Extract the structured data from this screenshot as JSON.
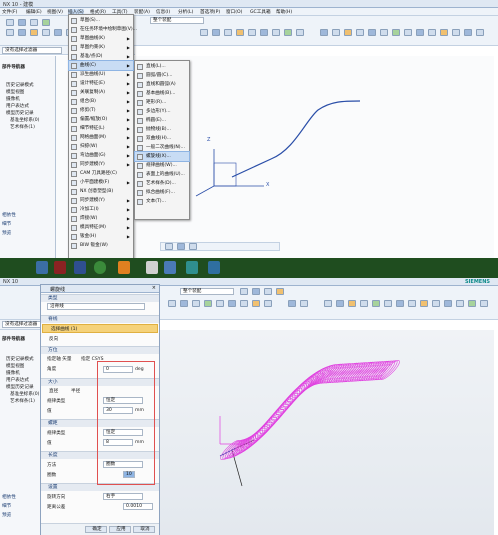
{
  "top": {
    "title_left": "NX 10 - 建模",
    "title_right": "SIEMENS",
    "menubar": [
      "文件(F)",
      "编辑(E)",
      "视图(V)",
      "插入(S)",
      "格式(R)",
      "工具(T)",
      "装配(A)",
      "信息(I)",
      "分析(L)",
      "首选项(P)",
      "窗口(O)",
      "GC工具箱",
      "帮助(H)"
    ],
    "filter_select": "整个装配",
    "left_select": "没有选择过滤器",
    "nav_title": "部件导航器",
    "nav_items": [
      "历史记录模式",
      "模型视图",
      "摄像机",
      "用户表达式",
      "模型历史记录",
      "基准坐标系(0)",
      "艺术样条(1)"
    ],
    "nav_bottom": [
      "相依性",
      "细节",
      "预览"
    ]
  },
  "insert_menu": {
    "items": [
      "草图(S)...",
      "在任务环境中绘制草图(V)...",
      "草图曲线(K)",
      "草图约束(K)",
      "基准/点(D)",
      "曲线(C)",
      "派生曲线(U)",
      "设计特征(E)",
      "关联复制(A)",
      "组合(B)",
      "修剪(T)",
      "偏置/缩放(O)",
      "细节特征(L)",
      "网格曲面(M)",
      "扫掠(W)",
      "弯边曲面(G)",
      "同步建模(Y)",
      "CAM 刀具路径(C)",
      "小平面建模(F)",
      "NX 创意塑型(B)",
      "同步建模(Y)",
      "冷加工(I)",
      "焊接(W)",
      "模具特征(M)",
      "钣金(H)",
      "BIW 钣金(W)"
    ],
    "selected_index": 5
  },
  "curve_submenu": {
    "items": [
      "直线(L)...",
      "圆弧/圆(C)...",
      "直线和圆弧(A)",
      "基本曲线(B)...",
      "矩形(R)...",
      "多边形(Y)...",
      "椭圆(E)...",
      "抛物线(B)...",
      "双曲线(H)...",
      "一般二次曲线(N)...",
      "螺旋线(X)...",
      "规律曲线(W)...",
      "表面上的曲线(U)...",
      "艺术样条(D)...",
      "拟合曲线(F)...",
      "文本(T)..."
    ],
    "selected_index": 10
  },
  "graph1": {
    "axis_x": "X",
    "axis_y": "Y",
    "axis_z": "Z"
  },
  "bottom": {
    "title_left": "NX 10",
    "dialog_title": "螺旋线",
    "filter_select": "整个装配",
    "left_select": "没有选择过滤器",
    "type_select": "沿脊线",
    "type_header": "类型",
    "spine_header": "脊线",
    "select_curve": "选择曲线 (1)",
    "reverse": "反向",
    "orient_header": "方位",
    "orient_options": [
      "指定轴 矢量",
      "指定 CSYS"
    ],
    "angle_label": "角度",
    "angle_value": "0",
    "angle_unit": "deg",
    "size_header": "大小",
    "size_options": [
      "直径",
      "半径"
    ],
    "law_type_label": "规律类型",
    "law_type_value": "恒定",
    "value_label": "值",
    "size_value": "30",
    "size_unit": "mm",
    "pitch_header": "螺距",
    "pitch_law_label": "规律类型",
    "pitch_law_value": "恒定",
    "pitch_value_label": "值",
    "pitch_value": "8",
    "pitch_unit": "mm",
    "length_header": "长度",
    "method_label": "方法",
    "method_value": "圈数",
    "turns_label": "圈数",
    "turns_value": "10",
    "settings_header": "设置",
    "rotate_label": "旋转方向",
    "rotate_value": "右手",
    "tolerance_label": "距离公差",
    "tolerance_value": "0.0010",
    "ok": "确定",
    "apply": "应用",
    "cancel": "取消",
    "nav_bottom": [
      "相依性",
      "细节",
      "预览"
    ]
  },
  "colors": {
    "helix": "#e040e0",
    "spline": "#2a4ea8",
    "dialog_red_box": "#e05050"
  }
}
